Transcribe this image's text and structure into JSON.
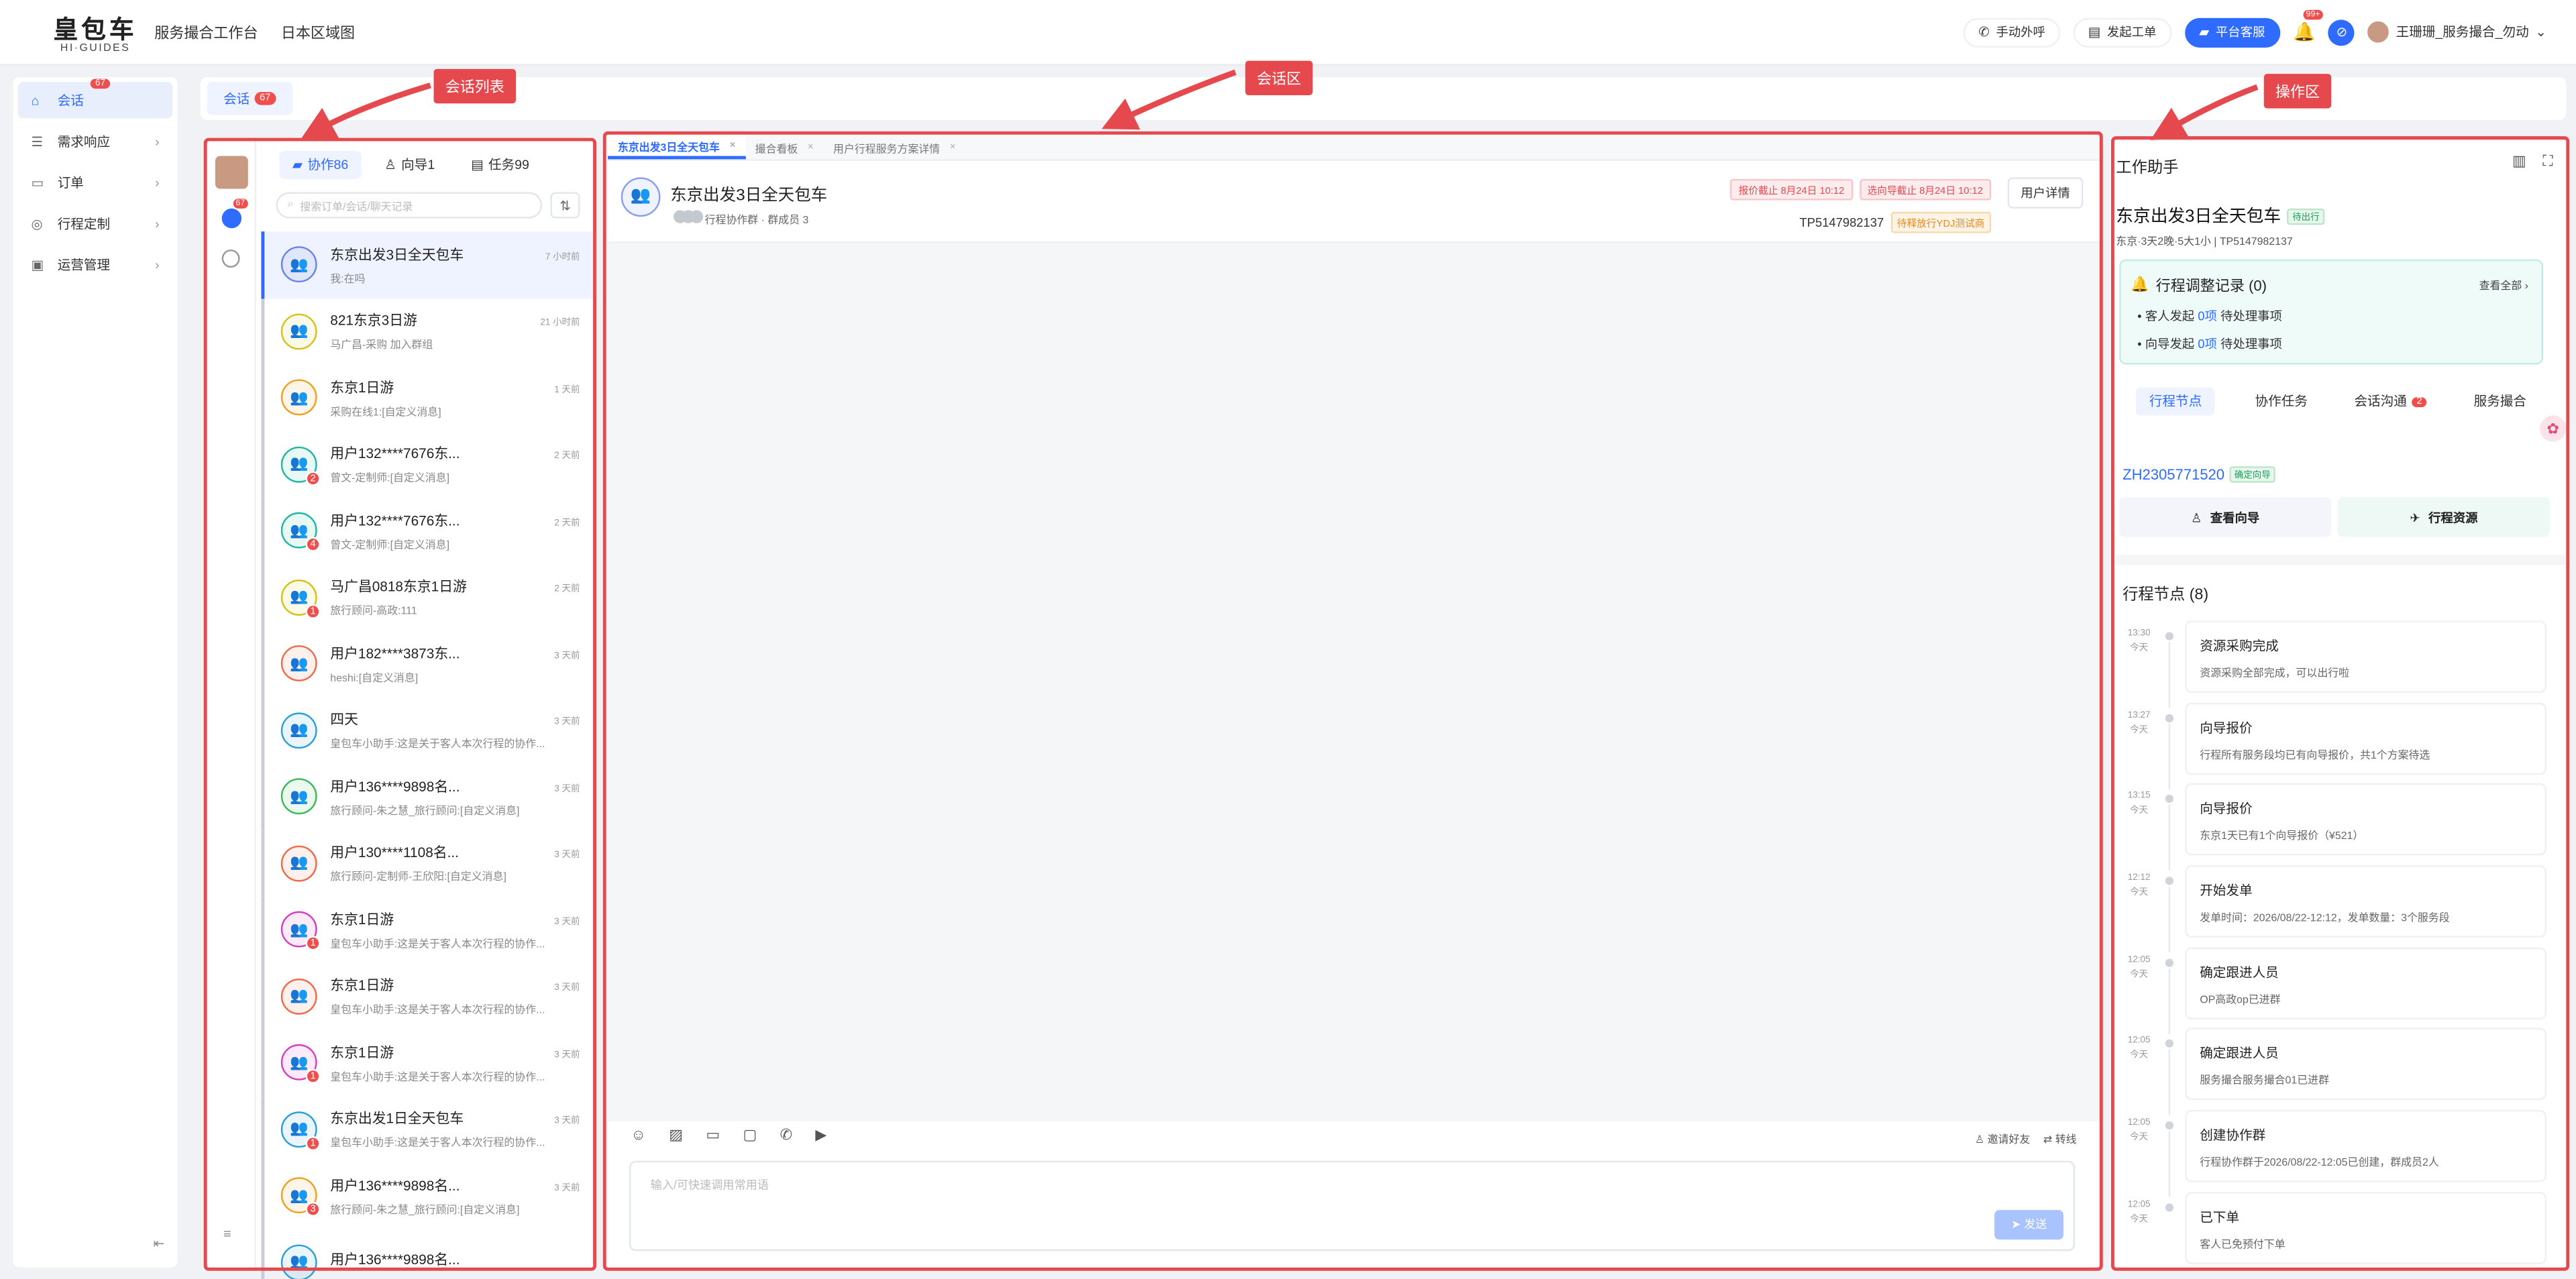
{
  "logo": {
    "cn": "皇包车",
    "en": "HI·GUIDES"
  },
  "topnav": [
    "服务撮合工作台",
    "日本区域图"
  ],
  "topright": {
    "call": "手动外呼",
    "ticket": "发起工单",
    "service": "平台客服",
    "bell_badge": "99+",
    "user": "王珊珊_服务撮合_勿动"
  },
  "sidebar": {
    "items": [
      {
        "label": "会话",
        "badge": "67"
      },
      {
        "label": "需求响应"
      },
      {
        "label": "订单"
      },
      {
        "label": "行程定制"
      },
      {
        "label": "运营管理"
      }
    ]
  },
  "tabstrip": {
    "label": "会话",
    "badge": "67"
  },
  "annotations": {
    "list": "会话列表",
    "chat": "会话区",
    "ops": "操作区"
  },
  "convlist": {
    "chat_badge": "67",
    "tabs": [
      "协作86",
      "向导1",
      "任务99"
    ],
    "search_placeholder": "搜索订单/会话/聊天记录",
    "items": [
      {
        "name": "东京出发3日全天包车",
        "time": "7 小时前",
        "preview": "我:在吗",
        "color": "#6a83e8",
        "badge": ""
      },
      {
        "name": "821东京3日游",
        "time": "21 小时前",
        "preview": "马广昌-采购 加入群组",
        "color": "#d4c21a",
        "badge": ""
      },
      {
        "name": "东京1日游",
        "time": "1 天前",
        "preview": "采购在线1:[自定义消息]",
        "color": "#f0a020",
        "badge": ""
      },
      {
        "name": "用户132****7676东...",
        "time": "2 天前",
        "preview": "曾文-定制师:[自定义消息]",
        "color": "#1fb8a0",
        "badge": "2"
      },
      {
        "name": "用户132****7676东...",
        "time": "2 天前",
        "preview": "曾文-定制师:[自定义消息]",
        "color": "#1fb8a0",
        "badge": "4"
      },
      {
        "name": "马广昌0818东京1日游",
        "time": "2 天前",
        "preview": "旅行顾问-高政:111",
        "color": "#d4c21a",
        "badge": "1"
      },
      {
        "name": "用户182****3873东...",
        "time": "3 天前",
        "preview": "heshi:[自定义消息]",
        "color": "#f06a4a",
        "badge": ""
      },
      {
        "name": "四天",
        "time": "3 天前",
        "preview": "皇包车小助手:这是关于客人本次行程的协作...",
        "color": "#2a9fd8",
        "badge": ""
      },
      {
        "name": "用户136****9898名...",
        "time": "3 天前",
        "preview": "旅行顾问-朱之慧_旅行顾问:[自定义消息]",
        "color": "#3cb95c",
        "badge": ""
      },
      {
        "name": "用户130****1108名...",
        "time": "3 天前",
        "preview": "旅行顾问-定制师-王欣阳:[自定义消息]",
        "color": "#f06a4a",
        "badge": ""
      },
      {
        "name": "东京1日游",
        "time": "3 天前",
        "preview": "皇包车小助手:这是关于客人本次行程的协作...",
        "color": "#d63fc0",
        "badge": "1"
      },
      {
        "name": "东京1日游",
        "time": "3 天前",
        "preview": "皇包车小助手:这是关于客人本次行程的协作...",
        "color": "#f06a4a",
        "badge": ""
      },
      {
        "name": "东京1日游",
        "time": "3 天前",
        "preview": "皇包车小助手:这是关于客人本次行程的协作...",
        "color": "#d63fc0",
        "badge": "1"
      },
      {
        "name": "东京出发1日全天包车",
        "time": "3 天前",
        "preview": "皇包车小助手:这是关于客人本次行程的协作...",
        "color": "#2a9fd8",
        "badge": "1"
      },
      {
        "name": "用户136****9898名...",
        "time": "3 天前",
        "preview": "旅行顾问-朱之慧_旅行顾问:[自定义消息]",
        "color": "#f0a020",
        "badge": "3"
      },
      {
        "name": "用户136****9898名...",
        "time": "",
        "preview": "",
        "color": "#2a9fd8",
        "badge": ""
      }
    ]
  },
  "chat": {
    "tabs": [
      "东京出发3日全天包车",
      "撮合看板",
      "用户行程服务方案详情"
    ],
    "title": "东京出发3日全天包车",
    "sub": "行程协作群 · 群成员 3",
    "tag1": "报价截止 8月24日 10:12",
    "tag2": "选向导截止 8月24日 10:12",
    "user_btn": "用户详情",
    "tp": "TP5147982137",
    "tp_tag": "待释放行YDJ测试商",
    "invite": "邀请好友",
    "transfer": "转线",
    "placeholder": "输入/可快速调用常用语",
    "send": "发送"
  },
  "assistant": {
    "title": "工作助手",
    "name": "东京出发3日全天包车",
    "status": "待出行",
    "desc": "东京·3天2晚·5大1小 | TP5147982137",
    "adjust_title": "行程调整记录 (0)",
    "view_all": "查看全部 ›",
    "guest_line": {
      "pre": "客人发起",
      "num": "0项",
      "post": "待处理事项"
    },
    "guide_line": {
      "pre": "向导发起",
      "num": "0项",
      "post": "待处理事项"
    },
    "tabs": [
      "行程节点",
      "协作任务",
      "会话沟通",
      "服务撮合"
    ],
    "tab_badge": "2",
    "code": "ZH2305771520",
    "code_status": "确定向导",
    "btn_guide": "查看向导",
    "btn_resource": "行程资源",
    "nodes_title": "行程节点 (8)",
    "nodes": [
      {
        "time": "13:30",
        "day": "今天",
        "title": "资源采购完成",
        "desc": "资源采购全部完成，可以出行啦"
      },
      {
        "time": "13:27",
        "day": "今天",
        "title": "向导报价",
        "desc": "行程所有服务段均已有向导报价，共1个方案待选"
      },
      {
        "time": "13:15",
        "day": "今天",
        "title": "向导报价",
        "desc": "东京1天已有1个向导报价（¥521）"
      },
      {
        "time": "12:12",
        "day": "今天",
        "title": "开始发单",
        "desc": "发单时间：2026/08/22-12:12，发单数量：3个服务段"
      },
      {
        "time": "12:05",
        "day": "今天",
        "title": "确定跟进人员",
        "desc": "OP高政op已进群"
      },
      {
        "time": "12:05",
        "day": "今天",
        "title": "确定跟进人员",
        "desc": "服务撮合服务撮合01已进群"
      },
      {
        "time": "12:05",
        "day": "今天",
        "title": "创建协作群",
        "desc": "行程协作群于2026/08/22-12:05已创建，群成员2人"
      },
      {
        "time": "12:05",
        "day": "今天",
        "title": "已下单",
        "desc": "客人已免预付下单"
      }
    ]
  }
}
